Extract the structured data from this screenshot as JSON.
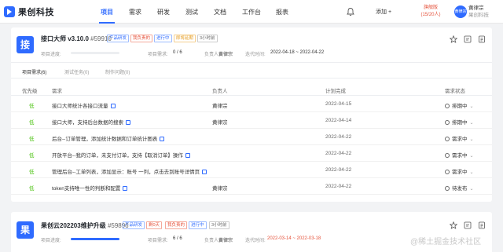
{
  "nav": {
    "brand": "果创科技",
    "items": [
      "项目",
      "需求",
      "研发",
      "测试",
      "文档",
      "工作台",
      "报表"
    ],
    "add_label": "添加 +",
    "plan_name": "旗舰版",
    "plan_seats": "(15/20人)",
    "avatar_text": "黄律宗",
    "user_name": "黄律宗",
    "company": "果创科技"
  },
  "colors": {
    "accent": "#2f6bff",
    "priority_low": "#52c41a",
    "overdue": "#e5533c"
  },
  "project1": {
    "icon_char": "接",
    "name": "接口大师 v3.10.0",
    "id": "#59910",
    "tags": [
      "产品研发",
      "我负责的",
      "进行中",
      "即将延期",
      "3小时前"
    ],
    "progress_label": "项目进度:",
    "req_label": "项目需求:",
    "req_value": "0 / 6",
    "owner_label": "负责人:",
    "owner": "黄律宗",
    "iter_label": "迭代时间:",
    "iter_time": "2022-04-18 ~ 2022-04-22",
    "progress": 0,
    "subtabs": [
      "项目需求(6)",
      "测试任务(0)",
      "制作问题(0)"
    ],
    "columns": [
      "优先级",
      "需求",
      "负责人",
      "计划完成",
      "需求状态"
    ],
    "rows": [
      {
        "prio": "低",
        "title": "接口大师统计各接口流量",
        "owner": "黄律宗",
        "date": "2022-04-15",
        "status": "排期中"
      },
      {
        "prio": "低",
        "title": "接口大师，支持后台数据的搜索",
        "owner": "黄律宗",
        "date": "2022-04-14",
        "status": "排期中"
      },
      {
        "prio": "低",
        "title": "后台--订单管理，添加统计数据和订单统计图表",
        "owner": "",
        "date": "2022-04-22",
        "status": "需求中"
      },
      {
        "prio": "低",
        "title": "开放平台--我的订单，未支付订单，支持【取消订单】操作",
        "owner": "",
        "date": "2022-04-22",
        "status": "需求中"
      },
      {
        "prio": "低",
        "title": "管理后台--工单列表，添加显示：账号 一列，点击去到账号详情页",
        "owner": "",
        "date": "2022-04-22",
        "status": "需求中"
      },
      {
        "prio": "低",
        "title": "token支持唯一性的判断和配置",
        "owner": "黄律宗",
        "date": "2022-04-22",
        "status": "待发布"
      }
    ]
  },
  "project2": {
    "icon_char": "果",
    "name": "果创云202203维护升级",
    "id": "#59896",
    "tags": [
      "产品研发",
      "剩0天",
      "我负责的",
      "进行中",
      "3小时前"
    ],
    "progress_label": "项目进度:",
    "req_label": "项目需求:",
    "req_value": "6 / 6",
    "owner_label": "负责人:",
    "owner": "黄律宗",
    "iter_label": "迭代时间:",
    "iter_time": "2022-03-14 ~ 2022-03-18",
    "progress": 100
  },
  "watermark": "@稀土掘金技术社区"
}
